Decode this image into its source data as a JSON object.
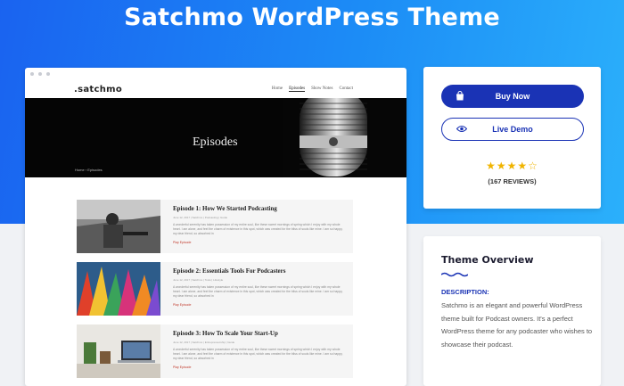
{
  "page": {
    "title": "Satchmo WordPress Theme"
  },
  "preview": {
    "logo": ".satchmo",
    "nav": [
      "Home",
      "Episodes",
      "Show Notes",
      "Contact"
    ],
    "banner_title": "Episodes",
    "breadcrumb": "Home  ›  Episodes",
    "episodes": [
      {
        "title": "Episode 1: How We Started Podcasting",
        "meta": "June 12, 2017  |  Satchmo  |  Podcasting  |  Guide",
        "excerpt": "A wonderful serenity has taken possession of my entire soul, like these sweet mornings of spring which I enjoy with my whole heart. I am alone, and feel the charm of existence in this spot, which was created for the bliss of souls like mine. I am so happy, my dear friend, so absorbed in",
        "play": "Play Episode"
      },
      {
        "title": "Episode 2: Essentials Tools For Podcasters",
        "meta": "June 12, 2017  |  Satchmo  |  Tools  |  Lifestyle",
        "excerpt": "A wonderful serenity has taken possession of my entire soul, like these sweet mornings of spring which I enjoy with my whole heart. I am alone, and feel the charm of existence in this spot, which was created for the bliss of souls like mine. I am so happy, my dear friend, so absorbed in",
        "play": "Play Episode"
      },
      {
        "title": "Episode 3: How To Scale Your Start-Up",
        "meta": "June 12, 2017  |  Satchmo  |  Entrepreneurship  |  Guide",
        "excerpt": "A wonderful serenity has taken possession of my entire soul, like these sweet mornings of spring which I enjoy with my whole heart. I am alone, and feel the charm of existence in this spot, which was created for the bliss of souls like mine. I am so happy, my dear friend, so absorbed in",
        "play": "Play Episode"
      }
    ]
  },
  "buy": {
    "buy_label": "Buy Now",
    "demo_label": "Live Demo",
    "rating": 4,
    "rating_max": 5,
    "reviews": "(167 REVIEWS)"
  },
  "overview": {
    "title": "Theme Overview",
    "description_label": "DESCRIPTION:",
    "description": "Satchmo is an elegant and powerful WordPress theme built for Podcast owners. It's a perfect WordPress theme for any podcaster who wishes to showcase their podcast."
  },
  "colors": {
    "accent": "#1a33b5",
    "hero_start": "#1a63f0",
    "hero_end": "#2bb0fb",
    "star": "#f0b400",
    "play": "#c0392b"
  },
  "icons": {
    "buy": "shopping-bag-icon",
    "demo": "eye-icon",
    "star": "star-icon"
  }
}
